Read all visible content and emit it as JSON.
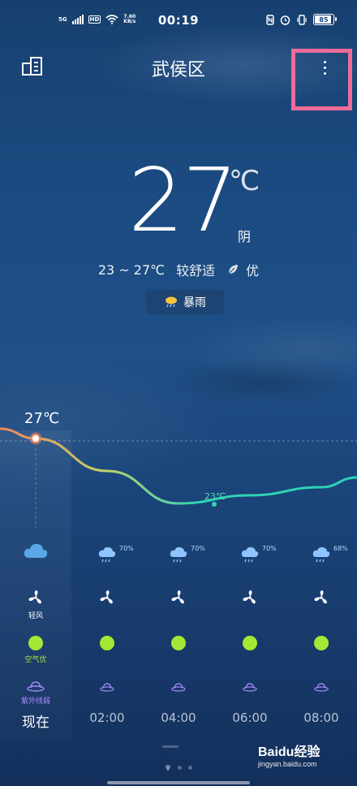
{
  "status_bar": {
    "signal_label": "5G",
    "hd_badge": "HD",
    "net_speed_value": "7.60",
    "net_speed_unit": "KB/s",
    "time": "00:19",
    "battery": "85"
  },
  "header": {
    "city": "武侯区",
    "icons": [
      "city-manage-icon",
      "more-vertical-icon"
    ]
  },
  "current": {
    "temp": "27",
    "unit": "℃",
    "condition": "阴",
    "range": "23 ~ 27℃",
    "comfort": "较舒适",
    "aqi": "优",
    "alert": "暴雨"
  },
  "chart_data": {
    "type": "line",
    "title": "",
    "xlabel": "",
    "ylabel": "",
    "x": [
      "现在",
      "02:00",
      "04:00",
      "06:00",
      "08:00"
    ],
    "series": [
      {
        "values": [
          27,
          25,
          23,
          23.5,
          24
        ]
      }
    ],
    "labels": {
      "high": "27℃",
      "low": "23℃"
    },
    "ylim": [
      22,
      28
    ],
    "grid": false
  },
  "forecast": {
    "columns": [
      {
        "time": "现在",
        "pop": "",
        "wind_label": "轻风",
        "aqi_label": "空气优",
        "uv_label": "紫外线弱",
        "icon": "cloud-icon"
      },
      {
        "time": "02:00",
        "pop": "70%",
        "wind_label": "",
        "aqi_label": "",
        "uv_label": "",
        "icon": "rain-icon"
      },
      {
        "time": "04:00",
        "pop": "70%",
        "wind_label": "",
        "aqi_label": "",
        "uv_label": "",
        "icon": "rain-icon"
      },
      {
        "time": "06:00",
        "pop": "70%",
        "wind_label": "",
        "aqi_label": "",
        "uv_label": "",
        "icon": "rain-icon"
      },
      {
        "time": "08:00",
        "pop": "68%",
        "wind_label": "",
        "aqi_label": "",
        "uv_label": "",
        "icon": "rain-icon"
      }
    ]
  },
  "watermark": {
    "brand": "Baidu经验",
    "url": "jingyan.baidu.com"
  },
  "colors": {
    "bg_top": "#17406f",
    "bg_mid": "#1e4f86",
    "curve_warm": "#f08a5d",
    "curve_cool": "#2fd3b4",
    "aqi_good": "#a4e835",
    "uv_weak": "#a98bff",
    "highlight": "#ef6b9a"
  }
}
